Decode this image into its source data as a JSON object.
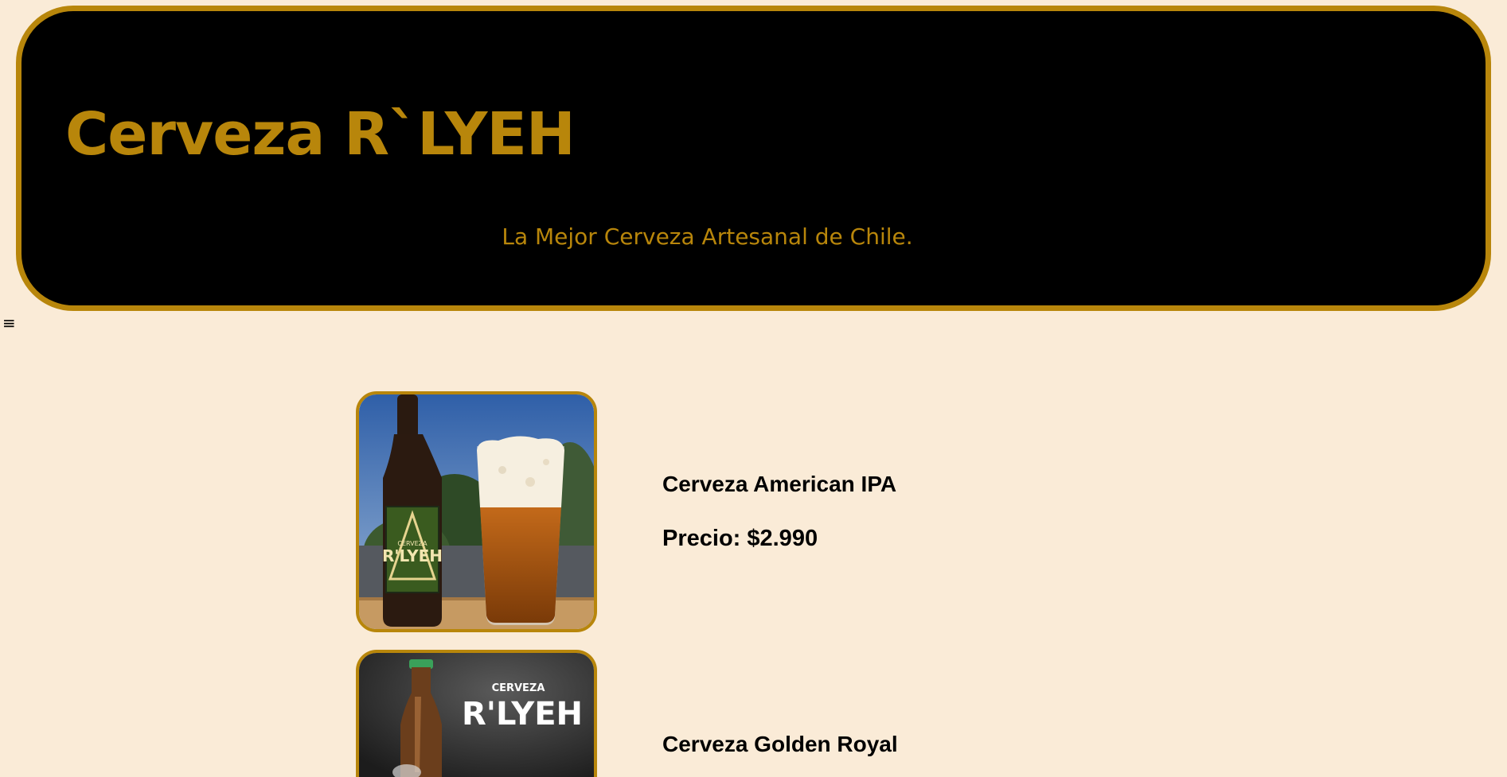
{
  "header": {
    "title": "Cerveza R`LYEH",
    "tagline": "La Mejor Cerveza Artesanal de Chile."
  },
  "nav": {
    "menu_icon": "≡"
  },
  "products": [
    {
      "name": "Cerveza American IPA",
      "price": "Precio: $2.990",
      "image_label": "R'LYEH",
      "image_label_top": "CERVEZA"
    },
    {
      "name": "Cerveza Golden Royal",
      "price": "",
      "image_label": "R'LYEH",
      "image_label_top": "CERVEZA"
    }
  ],
  "colors": {
    "background": "#faebd7",
    "accent": "#b8860b",
    "header_bg": "#000000"
  }
}
